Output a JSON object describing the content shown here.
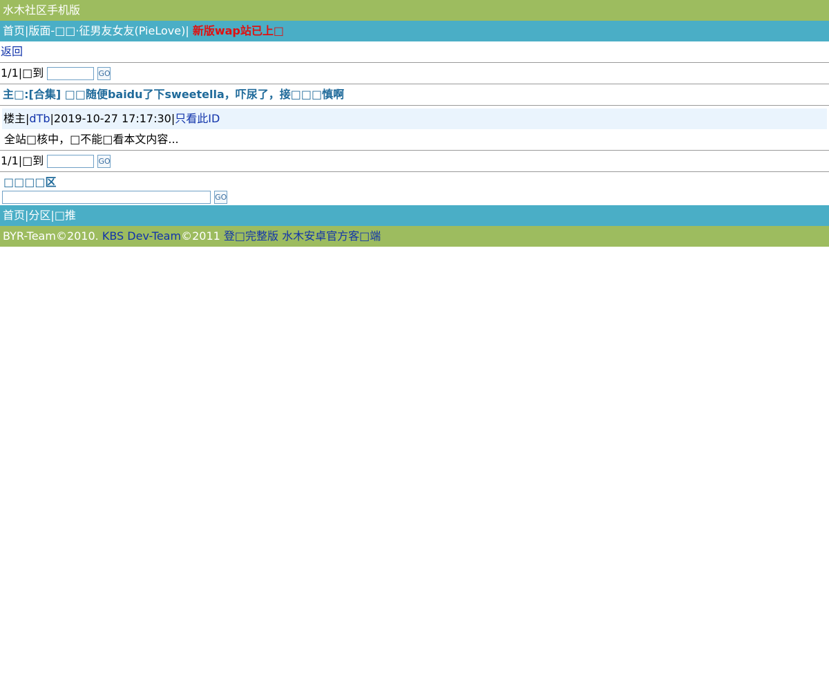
{
  "header": {
    "site_title": "水木社区手机版"
  },
  "nav": {
    "home": "首页",
    "sep1": "|",
    "board_prefix": "版面-",
    "board_name": "□□·征男友女友(PieLove)",
    "sep2": "|",
    "notice": "新版wap站已上□"
  },
  "back_link": "返回",
  "pager_top": {
    "page_info": "1/1|□到",
    "go_label": "GO",
    "input_value": ""
  },
  "topic": {
    "title": "主□:[合集] □□随便baidu了下sweetella，吓尿了，接□□□慎啊"
  },
  "post": {
    "floor": "楼主",
    "sep1": "|",
    "author": "dTb",
    "sep2": "|",
    "time": "2019-10-27 17:17:30",
    "sep3": "|",
    "only_this_id": "只看此ID",
    "content": "全站□核中，□不能□看本文内容..."
  },
  "pager_bottom": {
    "page_info": "1/1|□到",
    "go_label": "GO",
    "input_value": ""
  },
  "search": {
    "label": "□□□□区",
    "go_label": "GO",
    "input_value": ""
  },
  "bottom_nav": {
    "home": "首页",
    "sep1": "|",
    "sections": "分区",
    "sep2": "|",
    "recommend": "□推"
  },
  "footer": {
    "byr": "BYR-Team©2010.",
    "kbs": "KBS Dev-Team",
    "kbs_year": "©2011",
    "login_full": "登□完整版",
    "android": "水木安卓官方客□端"
  },
  "colors": {
    "green_bar": "#9dbc5f",
    "blue_bar": "#4aaec6",
    "notice": "#e01010",
    "link": "#1133aa",
    "title": "#1f6a9a",
    "post_header_bg": "#eaf4fd"
  }
}
